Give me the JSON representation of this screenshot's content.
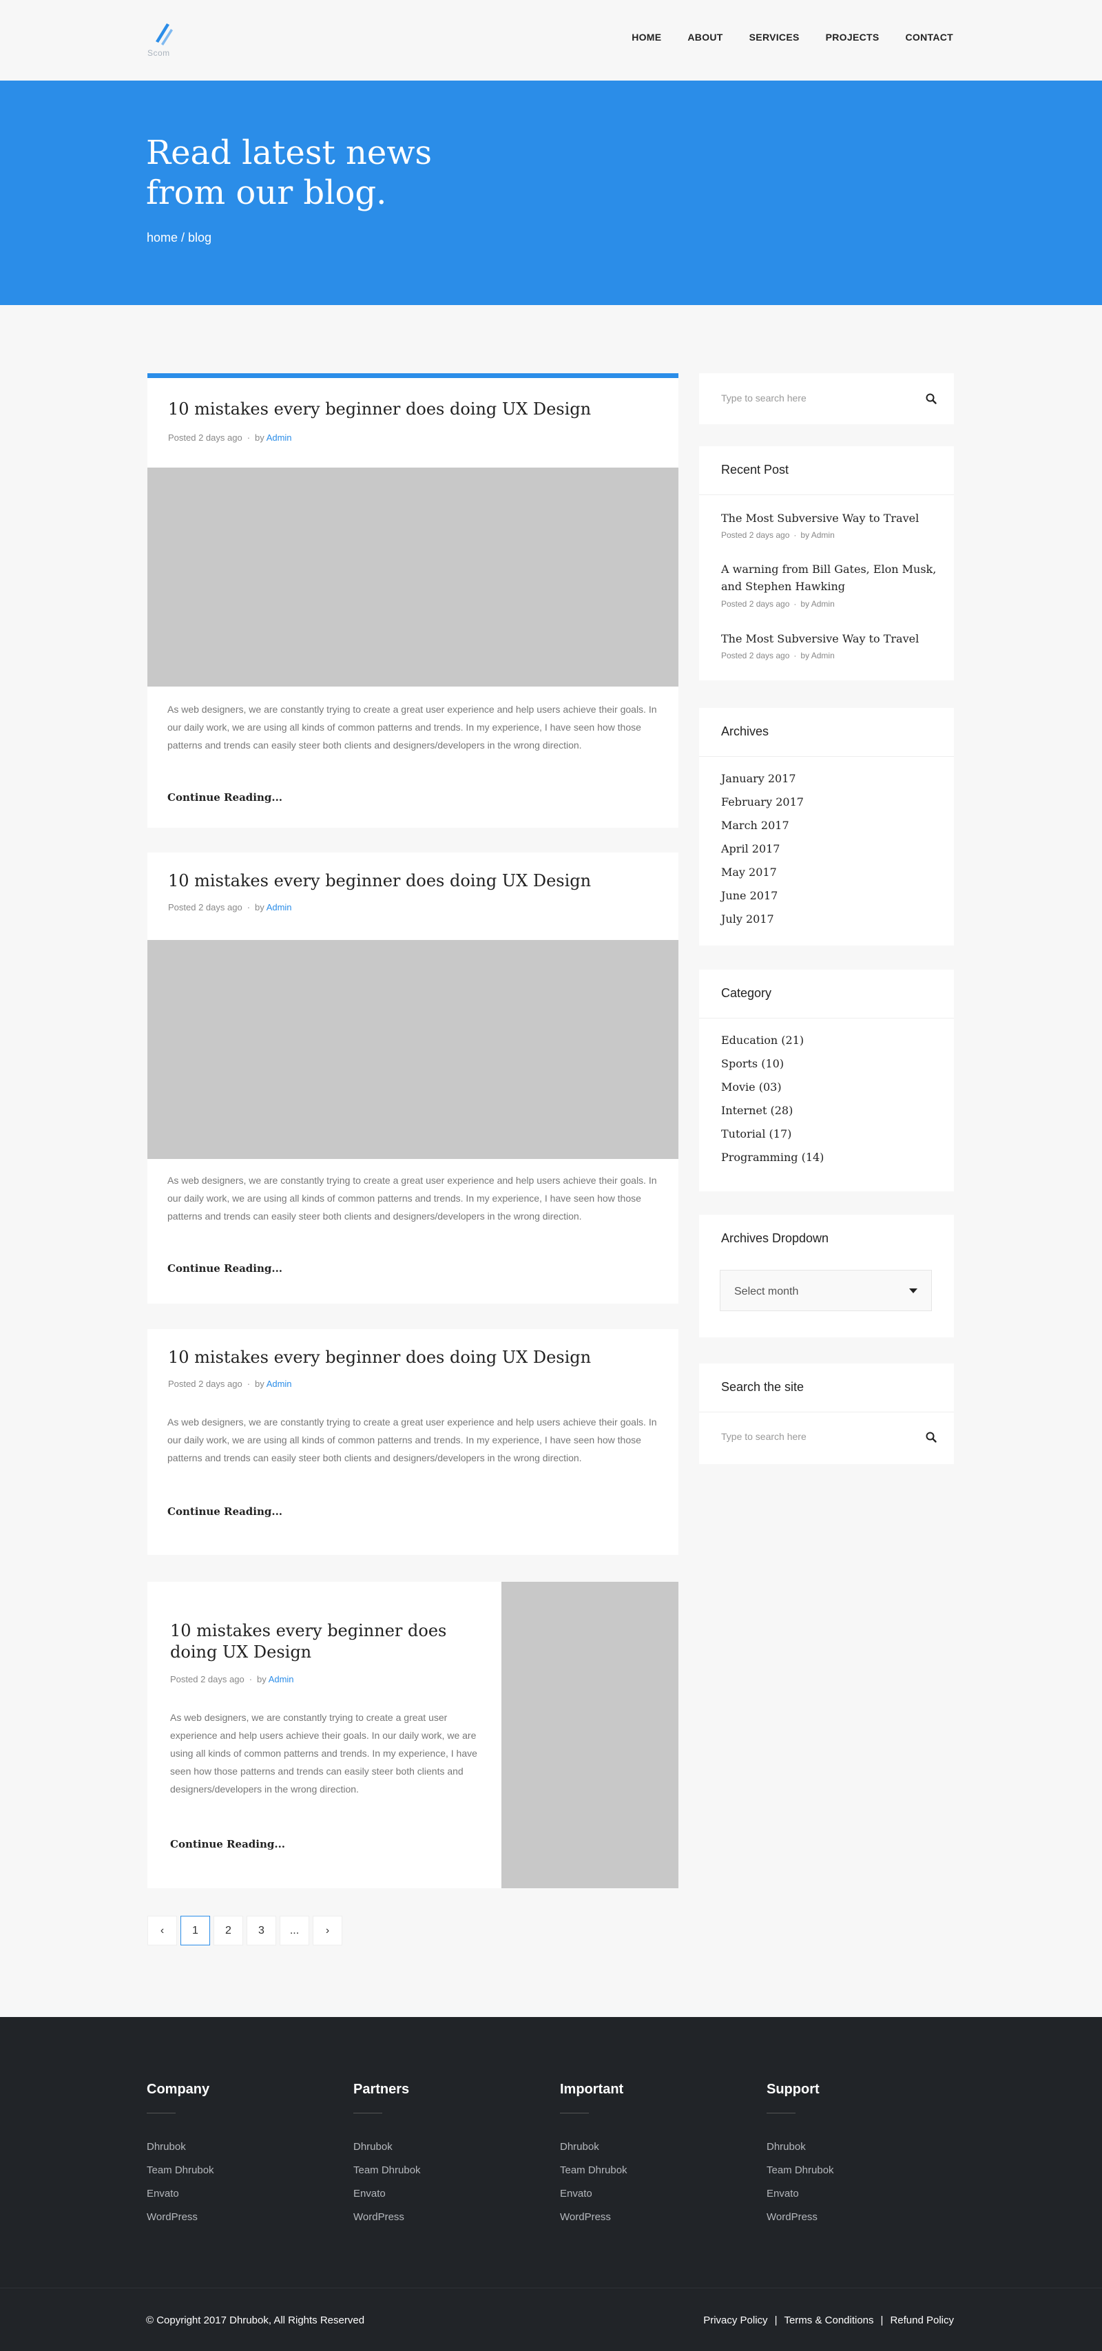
{
  "header": {
    "logo_text": "Scom",
    "nav": [
      "HOME",
      "ABOUT",
      "SERVICES",
      "PROJECTS",
      "CONTACT"
    ]
  },
  "hero": {
    "title_line1": "Read latest news",
    "title_line2": "from our blog.",
    "breadcrumb": "home / blog"
  },
  "posts": [
    {
      "title": "10 mistakes every beginner does doing UX Design",
      "posted": "Posted 2 days ago",
      "by": "by",
      "author": "Admin",
      "excerpt": "As web designers, we are constantly trying to create a great user experience and help users achieve their goals. In our daily work, we are using all kinds of common patterns and trends. In my experience, I have seen how those patterns and trends can easily steer both clients and designers/developers in the wrong direction.",
      "more": "Continue Reading..."
    },
    {
      "title": "10 mistakes every beginner does doing UX Design",
      "posted": "Posted 2 days ago",
      "by": "by",
      "author": "Admin",
      "excerpt": "As web designers, we are constantly trying to create a great user experience and help users achieve their goals. In our daily work, we are using all kinds of common patterns and trends. In my experience, I have seen how those patterns and trends can easily steer both clients and designers/developers in the wrong direction.",
      "more": "Continue Reading..."
    },
    {
      "title": "10 mistakes every beginner does doing UX Design",
      "posted": "Posted 2 days ago",
      "by": "by",
      "author": "Admin",
      "excerpt": "As web designers, we are constantly trying to create a great user experience and help users achieve their goals. In our daily work, we are using all kinds of common patterns and trends. In my experience, I have seen how those patterns and trends can easily steer both clients and designers/developers in the wrong direction.",
      "more": "Continue Reading..."
    },
    {
      "title": "10 mistakes every beginner does doing UX Design",
      "posted": "Posted 2 days ago",
      "by": "by",
      "author": "Admin",
      "excerpt": "As web designers, we are constantly trying to create a great user experience and help users achieve their goals. In our daily work, we are using all kinds of common patterns and trends. In my experience, I have seen how those patterns and trends can easily steer both clients and designers/developers in the wrong direction.",
      "more": "Continue Reading..."
    }
  ],
  "pagination": {
    "prev": "‹",
    "pages": [
      "1",
      "2",
      "3",
      "..."
    ],
    "next": "›",
    "active": "1"
  },
  "sidebar": {
    "search": {
      "placeholder": "Type to search here"
    },
    "recent": {
      "title": "Recent Post",
      "items": [
        {
          "title": "The Most Subversive Way to Travel",
          "posted": "Posted 2 days ago",
          "by": "by Admin"
        },
        {
          "title": "A warning from Bill Gates, Elon Musk, and Stephen Hawking",
          "posted": "Posted 2 days ago",
          "by": "by Admin"
        },
        {
          "title": "The Most Subversive Way to Travel",
          "posted": "Posted 2 days ago",
          "by": "by Admin"
        }
      ]
    },
    "archives": {
      "title": "Archives",
      "items": [
        "January 2017",
        "February 2017",
        "March 2017",
        "April 2017",
        "May 2017",
        "June 2017",
        "July 2017"
      ]
    },
    "category": {
      "title": "Category",
      "items": [
        "Education  (21)",
        "Sports  (10)",
        "Movie  (03)",
        "Internet  (28)",
        "Tutorial  (17)",
        "Programming  (14)"
      ]
    },
    "archives_dropdown": {
      "title": "Archives Dropdown",
      "value": "Select month"
    },
    "search_site": {
      "title": "Search the site",
      "placeholder": "Type to search here"
    }
  },
  "footer": {
    "columns": [
      {
        "title": "Company",
        "links": [
          "Dhrubok",
          "Team Dhrubok",
          "Envato",
          "WordPress"
        ]
      },
      {
        "title": "Partners",
        "links": [
          "Dhrubok",
          "Team Dhrubok",
          "Envato",
          "WordPress"
        ]
      },
      {
        "title": "Important",
        "links": [
          "Dhrubok",
          "Team Dhrubok",
          "Envato",
          "WordPress"
        ]
      },
      {
        "title": "Support",
        "links": [
          "Dhrubok",
          "Team Dhrubok",
          "Envato",
          "WordPress"
        ]
      }
    ],
    "copyright": "© Copyright 2017 Dhrubok, All Rights Reserved",
    "links": [
      "Privacy Policy",
      "|",
      "Terms & Conditions",
      "|",
      "Refund Policy"
    ]
  },
  "colors": {
    "accent": "#2b8de8",
    "footer_bg": "#212428",
    "image_placeholder": "#c8c8c8"
  }
}
